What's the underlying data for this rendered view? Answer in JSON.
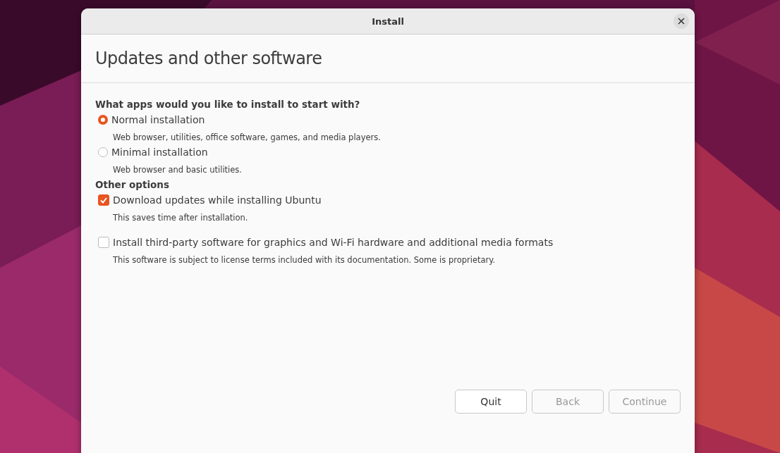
{
  "window": {
    "title": "Install"
  },
  "heading": "Updates and other software",
  "sections": [
    {
      "title": "What apps would you like to install to start with?",
      "options": [
        {
          "kind": "radio",
          "selected": true,
          "label": "Normal installation",
          "description": "Web browser, utilities, office software, games, and media players."
        },
        {
          "kind": "radio",
          "selected": false,
          "label": "Minimal installation",
          "description": "Web browser and basic utilities."
        }
      ]
    },
    {
      "title": "Other options",
      "options": [
        {
          "kind": "checkbox",
          "checked": true,
          "label": "Download updates while installing Ubuntu",
          "description": "This saves time after installation."
        },
        {
          "kind": "checkbox",
          "checked": false,
          "label": "Install third-party software for graphics and Wi-Fi hardware and additional media formats",
          "description": "This software is subject to license terms included with its documentation. Some is proprietary."
        }
      ]
    }
  ],
  "buttons": [
    {
      "label": "Quit",
      "disabled": false
    },
    {
      "label": "Back",
      "disabled": true
    },
    {
      "label": "Continue",
      "disabled": true
    }
  ]
}
